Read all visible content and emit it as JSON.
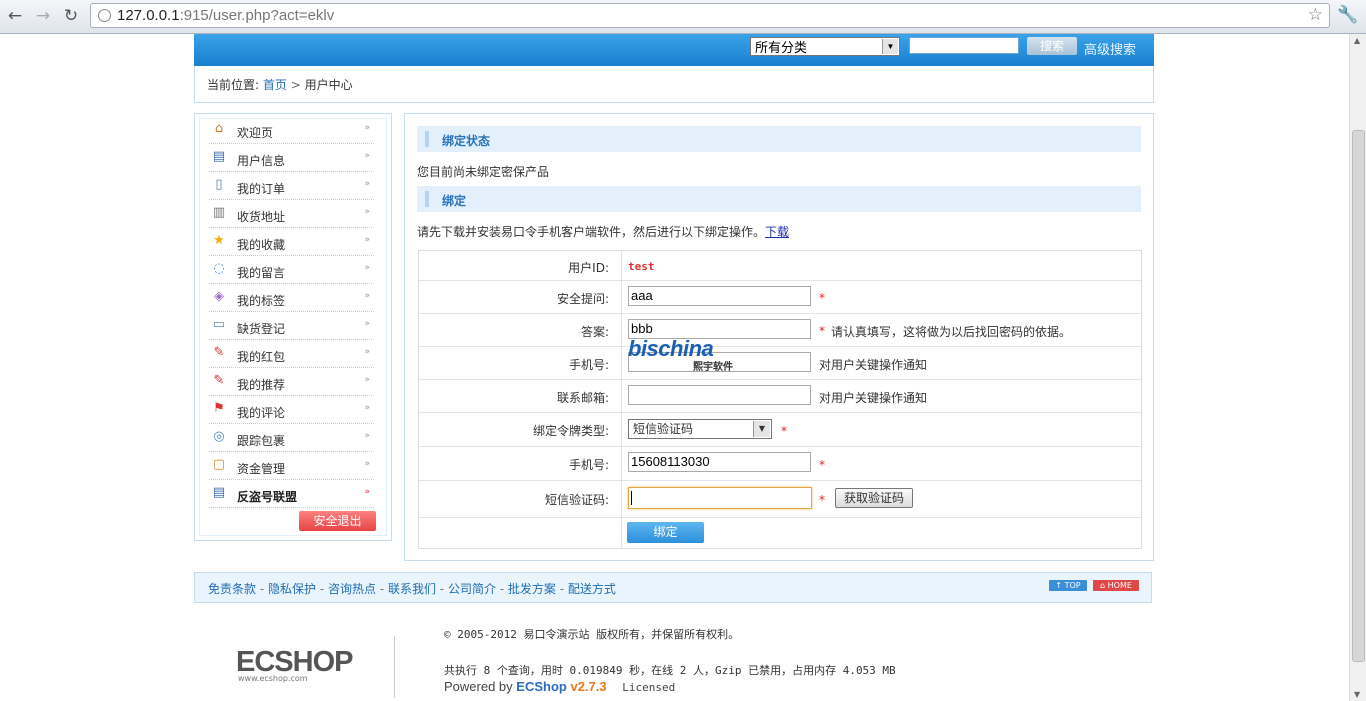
{
  "browser": {
    "url_host": "127.0.0.1",
    "url_rest": ":915/user.php?act=eklv"
  },
  "topbar": {
    "category_value": "所有分类",
    "search_button": "搜索",
    "advanced_search": "高级搜索"
  },
  "breadcrumb": {
    "prefix": "当前位置:",
    "home": "首页",
    "separator": ">",
    "current": "用户中心"
  },
  "sidebar": {
    "items": [
      {
        "label": "欢迎页",
        "icon": "house-icon"
      },
      {
        "label": "用户信息",
        "icon": "id-card-icon"
      },
      {
        "label": "我的订单",
        "icon": "document-icon"
      },
      {
        "label": "收货地址",
        "icon": "address-book-icon"
      },
      {
        "label": "我的收藏",
        "icon": "star-icon"
      },
      {
        "label": "我的留言",
        "icon": "speech-bubble-icon"
      },
      {
        "label": "我的标签",
        "icon": "tag-icon"
      },
      {
        "label": "缺货登记",
        "icon": "clipboard-icon"
      },
      {
        "label": "我的红包",
        "icon": "red-packet-icon"
      },
      {
        "label": "我的推荐",
        "icon": "recommend-icon"
      },
      {
        "label": "我的评论",
        "icon": "flag-icon"
      },
      {
        "label": "跟踪包裹",
        "icon": "chat-icon"
      },
      {
        "label": "资金管理",
        "icon": "wallet-icon"
      },
      {
        "label": "反盗号联盟",
        "icon": "id-card-icon"
      }
    ],
    "logout": "安全退出"
  },
  "main": {
    "status_title": "绑定状态",
    "status_text": "您目前尚未绑定密保产品",
    "bind_title": "绑定",
    "instruction": "请先下载并安装易口令手机客户端软件，然后进行以下绑定操作。",
    "download_link": "下载",
    "form": {
      "user_id_label": "用户ID:",
      "user_id_value": "test",
      "question_label": "安全提问:",
      "question_value": "aaa",
      "answer_label": "答案:",
      "answer_value": "bbb",
      "answer_note": "请认真填写，这将做为以后找回密码的依据。",
      "phone_label": "手机号:",
      "phone_note": "对用户关键操作通知",
      "email_label": "联系邮箱:",
      "email_note": "对用户关键操作通知",
      "token_type_label": "绑定令牌类型:",
      "token_type_value": "短信验证码",
      "mobile_label": "手机号:",
      "mobile_value": "15608113030",
      "sms_label": "短信验证码:",
      "sms_value": "",
      "get_code_button": "获取验证码",
      "bind_button": "绑定",
      "required_mark": "*"
    }
  },
  "watermark": {
    "text": "bischina",
    "subtext": "熙宇软件"
  },
  "footer": {
    "links": [
      "免责条款",
      "隐私保护",
      "咨询热点",
      "联系我们",
      "公司简介",
      "批发方案",
      "配送方式"
    ],
    "top_tag": "↑ TOP",
    "home_tag": "⌂ HOME",
    "logo_text": "ECSHOP",
    "logo_sub": "www.ecshop.com",
    "copyright": "© 2005-2012 易口令演示站 版权所有，并保留所有权利。",
    "stats": "共执行 8 个查询，用时 0.019849 秒，在线 2 人，Gzip 已禁用，占用内存 4.053 MB",
    "powered_prefix": "Powered by",
    "powered_brand": "ECShop",
    "powered_version": "v2.7.3",
    "licensed": "Licensed"
  },
  "colors": {
    "accent_blue": "#1a7fcf",
    "required_red": "#ee2222",
    "link_blue": "#1f6eb3"
  }
}
